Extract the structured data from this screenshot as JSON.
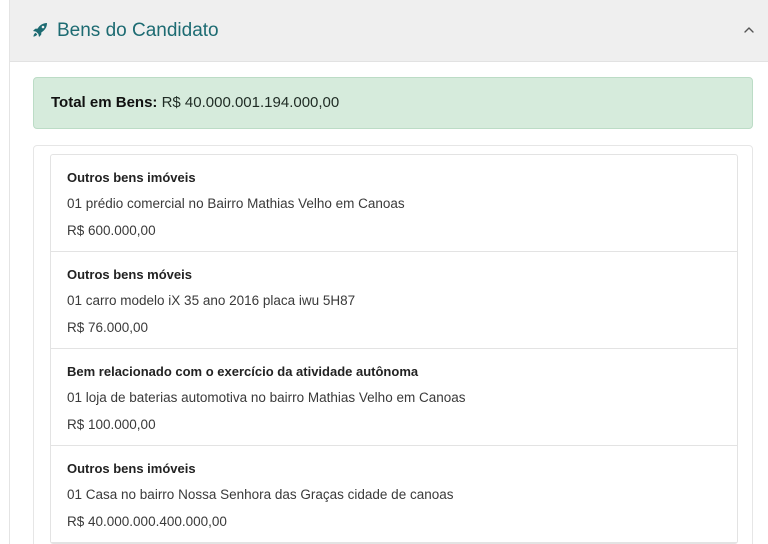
{
  "header": {
    "title": "Bens do Candidato",
    "icon": "rocket-icon",
    "toggle_icon": "chevron-up-icon",
    "title_color": "#1d6b72"
  },
  "total": {
    "label": "Total em Bens:",
    "value": "R$ 40.000.001.194.000,00",
    "background": "#d6ebdc"
  },
  "assets": [
    {
      "type": "Outros bens imóveis",
      "description": "01 prédio comercial no Bairro Mathias Velho em Canoas",
      "value": "R$ 600.000,00"
    },
    {
      "type": "Outros bens móveis",
      "description": "01 carro modelo iX 35 ano 2016 placa iwu 5H87",
      "value": "R$ 76.000,00"
    },
    {
      "type": "Bem relacionado com o exercício da atividade autônoma",
      "description": "01 loja de baterias automotiva no bairro Mathias Velho em Canoas",
      "value": "R$ 100.000,00"
    },
    {
      "type": "Outros bens imóveis",
      "description": "01 Casa no bairro Nossa Senhora das Graças cidade de canoas",
      "value": "R$ 40.000.000.400.000,00"
    }
  ]
}
